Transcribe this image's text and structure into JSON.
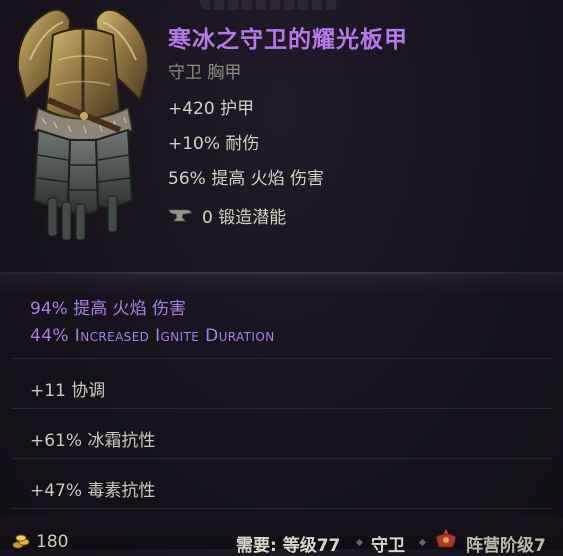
{
  "item": {
    "name": "寒冰之守卫的耀光板甲",
    "type": "守卫 胸甲",
    "implicits": [
      "+420 护甲",
      "+10% 耐伤",
      "56% 提高 火焰 伤害"
    ],
    "forging_potential": "0 锻造潜能"
  },
  "affixes": {
    "sealed": [
      "94% 提高 火焰 伤害",
      "44% Increased Ignite Duration"
    ],
    "normal": [
      "+11 协调",
      "+61% 冰霜抗性",
      "+47% 毒素抗性"
    ]
  },
  "footer": {
    "gold": "180",
    "requirement": "需要: 等级77",
    "class": "守卫",
    "faction": "阵营阶级7"
  },
  "colors": {
    "unique_name": "#b57ae8",
    "sealed_affix": "#a97fe0",
    "background": "#17121c"
  },
  "icons": {
    "forge": "anvil-icon",
    "gold": "gold-coin-icon",
    "faction": "faction-crest-icon"
  }
}
